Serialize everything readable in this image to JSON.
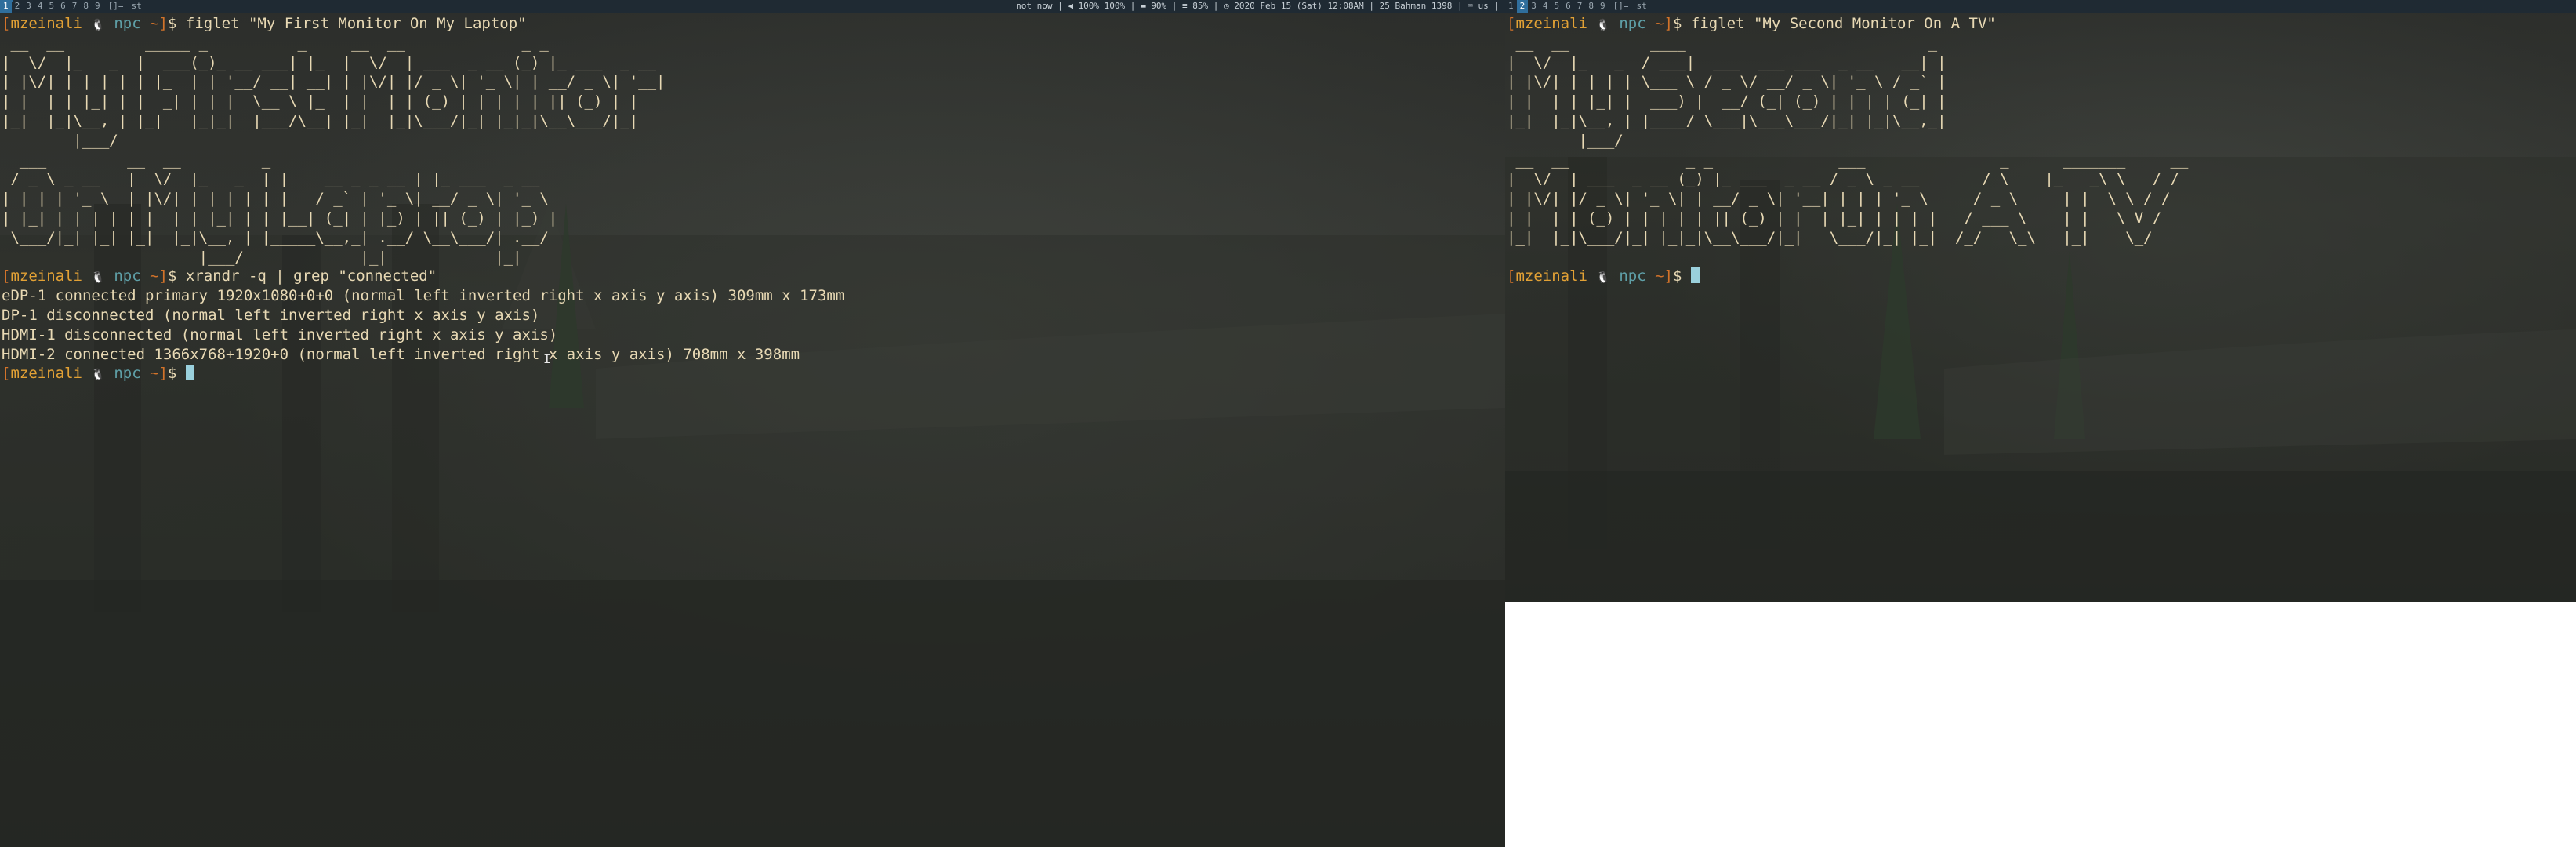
{
  "left_monitor": {
    "bar": {
      "tags": [
        "1",
        "2",
        "3",
        "4",
        "5",
        "6",
        "7",
        "8",
        "9"
      ],
      "selected_tag": "1",
      "layout": "[]=",
      "window_title": "st",
      "status": "not now | ◀ 100% 100% | ▬ 90% | ≡ 85% | ◷ 2020 Feb 15 (Sat) 12:08AM | 25 Bahman 1398 | ⌨ us |"
    },
    "lines": [
      {
        "type": "prompt",
        "user": "mzeinali",
        "host": "npc",
        "path": "~",
        "command": "figlet \"My First Monitor On My Laptop\""
      },
      {
        "type": "figlet",
        "text": " __  __         _____ _          _     __  __             _ _"
      },
      {
        "type": "figlet",
        "text": "|  \\/  |_   _  |  ___(_)_ __ ___| |_  |  \\/  | ___  _ __ (_) |_ ___  _ __"
      },
      {
        "type": "figlet",
        "text": "| |\\/| | | | | | |_  | | '__/ __| __| | |\\/| |/ _ \\| '_ \\| | __/ _ \\| '__|"
      },
      {
        "type": "figlet",
        "text": "| |  | | |_| | |  _| | | |  \\__ \\ |_  | |  | | (_) | | | | | || (_) | |"
      },
      {
        "type": "figlet",
        "text": "|_|  |_|\\__, | |_|   |_|_|  |___/\\__| |_|  |_|\\___/|_| |_|_|\\__\\___/|_|"
      },
      {
        "type": "figlet",
        "text": "        |___/"
      },
      {
        "type": "figlet",
        "text": "  ___         __  __         _"
      },
      {
        "type": "figlet",
        "text": " / _ \\ _ __   |  \\/  |_   _  | |    __ _ _ __ | |_ ___  _ __"
      },
      {
        "type": "figlet",
        "text": "| | | | '_ \\  | |\\/| | | | | | |   / _` | '_ \\| __/ _ \\| '_ \\"
      },
      {
        "type": "figlet",
        "text": "| |_| | | | | | |  | | |_| | | |__| (_| | |_) | || (_) | |_) |"
      },
      {
        "type": "figlet",
        "text": " \\___/|_| |_| |_|  |_|\\__, | |_____\\__,_| .__/ \\__\\___/| .__/"
      },
      {
        "type": "figlet",
        "text": "                      |___/             |_|            |_|"
      },
      {
        "type": "prompt",
        "user": "mzeinali",
        "host": "npc",
        "path": "~",
        "command": "xrandr -q | grep \"connected\""
      },
      {
        "type": "out",
        "text": "eDP-1 connected primary 1920x1080+0+0 (normal left inverted right x axis y axis) 309mm x 173mm"
      },
      {
        "type": "out",
        "text": "DP-1 disconnected (normal left inverted right x axis y axis)"
      },
      {
        "type": "out",
        "text": "HDMI-1 disconnected (normal left inverted right x axis y axis)"
      },
      {
        "type": "out",
        "text": "HDMI-2 connected 1366x768+1920+0 (normal left inverted right x axis y axis) 708mm x 398mm"
      },
      {
        "type": "prompt_cursor",
        "user": "mzeinali",
        "host": "npc",
        "path": "~",
        "command": ""
      }
    ]
  },
  "right_monitor": {
    "bar": {
      "tags": [
        "1",
        "2",
        "3",
        "4",
        "5",
        "6",
        "7",
        "8",
        "9"
      ],
      "selected_tag": "2",
      "layout": "[]=",
      "window_title": "st"
    },
    "lines": [
      {
        "type": "prompt",
        "user": "mzeinali",
        "host": "npc",
        "path": "~",
        "command": "figlet \"My Second Monitor On A TV\""
      },
      {
        "type": "figlet",
        "text": " __  __         ____                           _"
      },
      {
        "type": "figlet",
        "text": "|  \\/  |_   _  / ___|  ___  ___ ___  _ __   __| |"
      },
      {
        "type": "figlet",
        "text": "| |\\/| | | | | \\___ \\ / _ \\/ __/ _ \\| '_ \\ / _` |"
      },
      {
        "type": "figlet",
        "text": "| |  | | |_| |  ___) |  __/ (_| (_) | | | | (_| |"
      },
      {
        "type": "figlet",
        "text": "|_|  |_|\\__, | |____/ \\___|\\___\\___/|_| |_|\\__,_|"
      },
      {
        "type": "figlet",
        "text": "        |___/"
      },
      {
        "type": "figlet",
        "text": " __  __             _ _              ___               _      _______     __"
      },
      {
        "type": "figlet",
        "text": "|  \\/  | ___  _ __ (_) |_ ___  _ __ / _ \\ _ __       / \\    |_   _\\ \\   / /"
      },
      {
        "type": "figlet",
        "text": "| |\\/| |/ _ \\| '_ \\| | __/ _ \\| '__| | | | '_ \\     / _ \\     | |  \\ \\ / /"
      },
      {
        "type": "figlet",
        "text": "| |  | | (_) | | | | | || (_) | |  | |_| | | | |   / ___ \\    | |   \\ V /"
      },
      {
        "type": "figlet",
        "text": "|_|  |_|\\___/|_| |_|_|\\__\\___/|_|   \\___/|_| |_|  /_/   \\_\\   |_|    \\_/"
      },
      {
        "type": "figlet",
        "text": ""
      },
      {
        "type": "prompt_cursor",
        "user": "mzeinali",
        "host": "npc",
        "path": "~",
        "command": ""
      }
    ]
  },
  "colors": {
    "bar_bg": "#1f2a33",
    "tag_selected": "#2f6e9c",
    "prompt_bracket": "#d2732a",
    "prompt_user": "#e2a135",
    "prompt_host": "#5fa0a8",
    "text": "#e8d9b4",
    "cursor": "#9ad0dc"
  },
  "icons": {
    "tux": "tux-icon",
    "mouse_pointer": "ibeam-cursor-icon"
  }
}
